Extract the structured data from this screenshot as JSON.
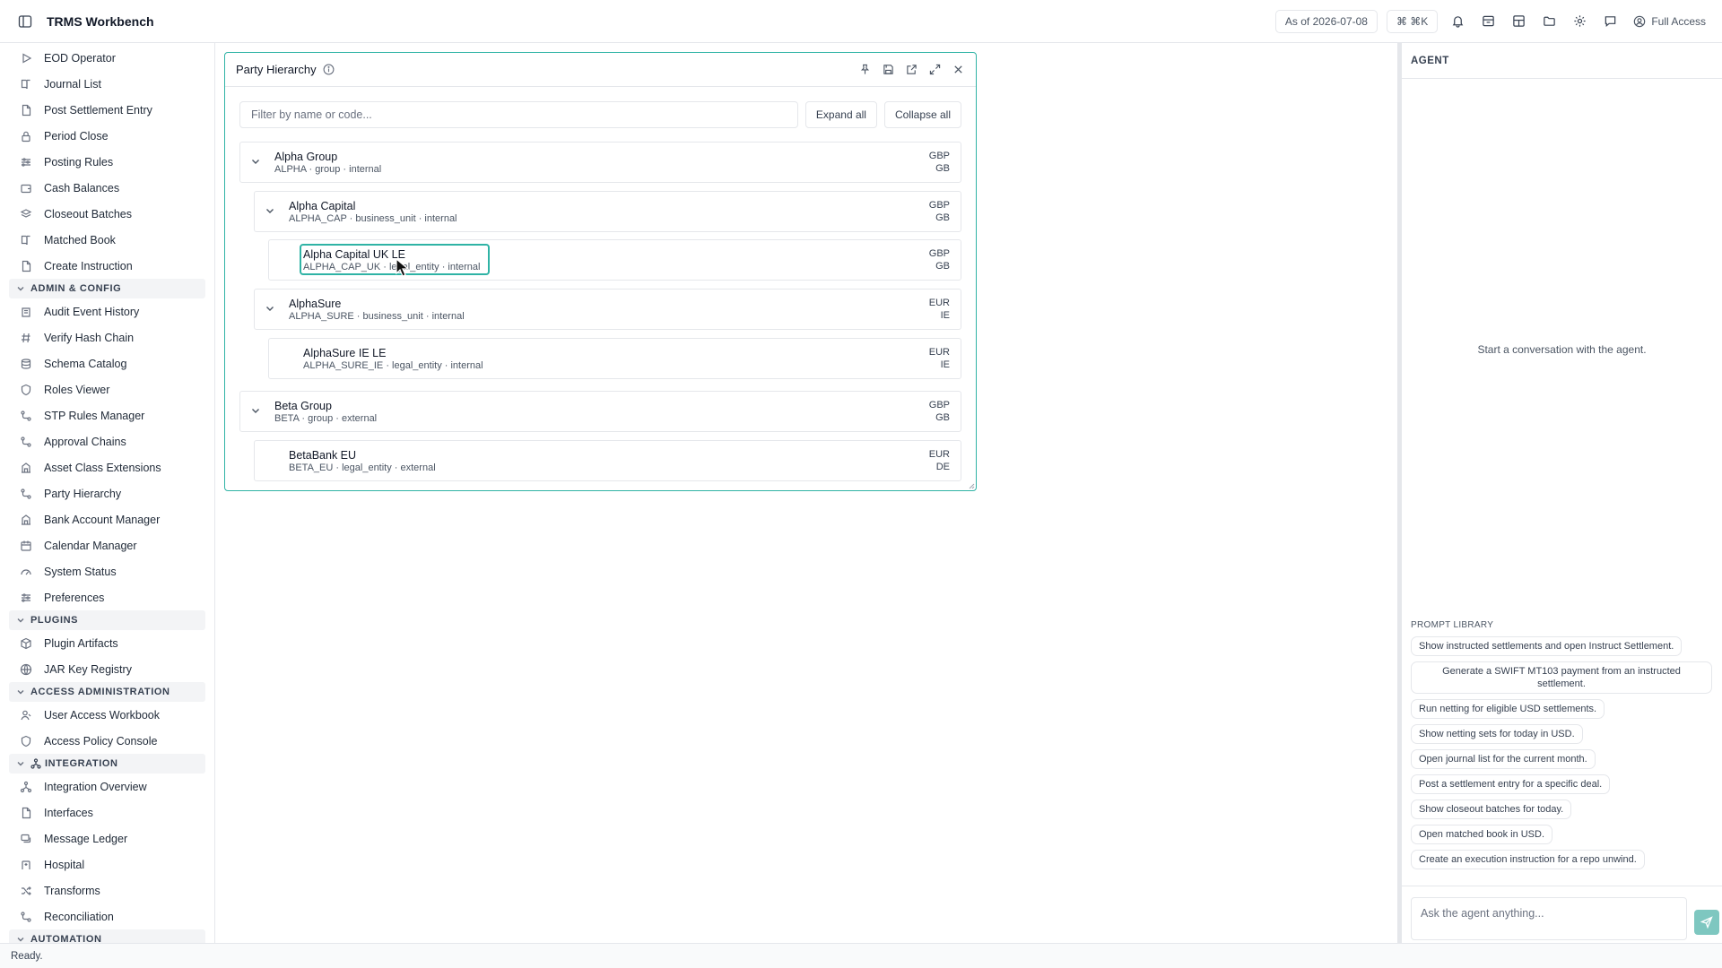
{
  "app": {
    "title": "TRMS Workbench"
  },
  "topbar": {
    "as_of": "As of 2026-07-08",
    "shortcut": "⌘ ⌘K",
    "access": "Full Access"
  },
  "sidebar": {
    "items_a": [
      {
        "label": "EOD Operator",
        "icon": "play-icon"
      },
      {
        "label": "Journal List",
        "icon": "book-icon"
      },
      {
        "label": "Post Settlement Entry",
        "icon": "document-icon"
      },
      {
        "label": "Period Close",
        "icon": "lock-icon"
      },
      {
        "label": "Posting Rules",
        "icon": "sliders-icon"
      },
      {
        "label": "Cash Balances",
        "icon": "wallet-icon"
      },
      {
        "label": "Closeout Batches",
        "icon": "layers-icon"
      },
      {
        "label": "Matched Book",
        "icon": "book-icon"
      },
      {
        "label": "Create Instruction",
        "icon": "document-icon"
      }
    ],
    "section_admin": "ADMIN & CONFIG",
    "items_b": [
      {
        "label": "Audit Event History",
        "icon": "history-icon"
      },
      {
        "label": "Verify Hash Chain",
        "icon": "hash-icon"
      },
      {
        "label": "Schema Catalog",
        "icon": "database-icon"
      },
      {
        "label": "Roles Viewer",
        "icon": "shield-icon"
      },
      {
        "label": "STP Rules Manager",
        "icon": "workflow-icon"
      },
      {
        "label": "Approval Chains",
        "icon": "workflow-icon"
      },
      {
        "label": "Asset Class Extensions",
        "icon": "building-icon"
      },
      {
        "label": "Party Hierarchy",
        "icon": "workflow-icon"
      },
      {
        "label": "Bank Account Manager",
        "icon": "building-icon"
      },
      {
        "label": "Calendar Manager",
        "icon": "calendar-icon"
      },
      {
        "label": "System Status",
        "icon": "gauge-icon"
      },
      {
        "label": "Preferences",
        "icon": "sliders-icon"
      }
    ],
    "section_plugins": "PLUGINS",
    "items_c": [
      {
        "label": "Plugin Artifacts",
        "icon": "package-icon"
      },
      {
        "label": "JAR Key Registry",
        "icon": "globe-icon"
      }
    ],
    "section_access": "ACCESS ADMINISTRATION",
    "items_d": [
      {
        "label": "User Access Workbook",
        "icon": "user-icon"
      },
      {
        "label": "Access Policy Console",
        "icon": "shield-icon"
      }
    ],
    "section_integration": "INTEGRATION",
    "items_e": [
      {
        "label": "Integration Overview",
        "icon": "network-icon"
      },
      {
        "label": "Interfaces",
        "icon": "document-icon"
      },
      {
        "label": "Message Ledger",
        "icon": "messages-icon"
      },
      {
        "label": "Hospital",
        "icon": "hospital-icon"
      },
      {
        "label": "Transforms",
        "icon": "shuffle-icon"
      },
      {
        "label": "Reconciliation",
        "icon": "workflow-icon"
      }
    ],
    "section_automation": "AUTOMATION"
  },
  "panel": {
    "title": "Party Hierarchy",
    "filter_placeholder": "Filter by name or code...",
    "expand_all": "Expand all",
    "collapse_all": "Collapse all",
    "nodes": [
      {
        "name": "Alpha Group",
        "meta": "ALPHA · group · internal",
        "currency": "GBP",
        "country": "GB",
        "expanded": true
      },
      {
        "name": "Alpha Capital",
        "meta": "ALPHA_CAP · business_unit · internal",
        "currency": "GBP",
        "country": "GB",
        "expanded": true
      },
      {
        "name": "Alpha Capital UK LE",
        "meta": "ALPHA_CAP_UK · legal_entity · internal",
        "currency": "GBP",
        "country": "GB",
        "selected": true
      },
      {
        "name": "AlphaSure",
        "meta": "ALPHA_SURE · business_unit · internal",
        "currency": "EUR",
        "country": "IE",
        "expanded": true
      },
      {
        "name": "AlphaSure IE LE",
        "meta": "ALPHA_SURE_IE · legal_entity · internal",
        "currency": "EUR",
        "country": "IE"
      },
      {
        "name": "Beta Group",
        "meta": "BETA · group · external",
        "currency": "GBP",
        "country": "GB",
        "expanded": true
      },
      {
        "name": "BetaBank EU",
        "meta": "BETA_EU · legal_entity · external",
        "currency": "EUR",
        "country": "DE"
      }
    ]
  },
  "agent": {
    "title": "AGENT",
    "empty": "Start a conversation with the agent.",
    "prompt_library_title": "PROMPT LIBRARY",
    "prompts": [
      "Show instructed settlements and open Instruct Settlement.",
      "Generate a SWIFT MT103 payment from an instructed settlement.",
      "Run netting for eligible USD settlements.",
      "Show netting sets for today in USD.",
      "Open journal list for the current month.",
      "Post a settlement entry for a specific deal.",
      "Show closeout batches for today.",
      "Open matched book in USD.",
      "Create an execution instruction for a repo unwind."
    ],
    "input_placeholder": "Ask the agent anything..."
  },
  "status": {
    "text": "Ready."
  },
  "colors": {
    "accent": "#2fb3a5",
    "send": "#7ec7c0"
  }
}
